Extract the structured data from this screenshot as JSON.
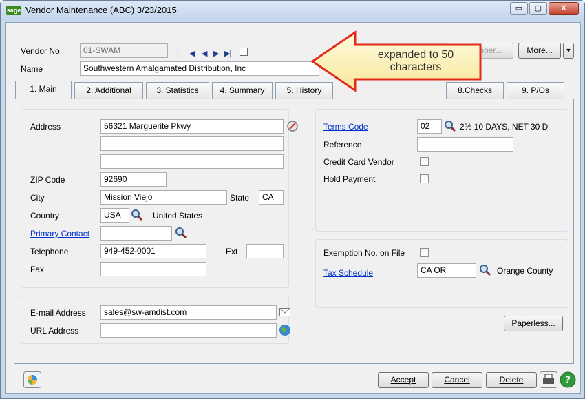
{
  "window": {
    "title": "Vendor Maintenance (ABC) 3/23/2015",
    "app_logo": "sage",
    "controls": {
      "minimize": "▭",
      "maximize": "▢",
      "close": "X"
    }
  },
  "header": {
    "vendor_no_label": "Vendor No.",
    "vendor_no_value": "01-SWAM",
    "name_label": "Name",
    "name_value": "Southwestern Amalgamated Distribution, Inc",
    "renumber_label": "Renumber...",
    "more_label": "More...",
    "callout": "expanded to 50 characters"
  },
  "tabs": [
    {
      "label": "1. Main"
    },
    {
      "label": "2. Additional"
    },
    {
      "label": "3. Statistics"
    },
    {
      "label": "4. Summary"
    },
    {
      "label": "5. History"
    },
    {
      "label": "8.Checks"
    },
    {
      "label": "9. P/Os"
    }
  ],
  "address": {
    "address_label": "Address",
    "line1": "56321 Marguerite Pkwy",
    "line2": "",
    "line3": "",
    "zip_label": "ZIP Code",
    "zip": "92690",
    "city_label": "City",
    "city": "Mission Viejo",
    "state_label": "State",
    "state": "CA",
    "country_label": "Country",
    "country_code": "USA",
    "country_name": "United States",
    "primary_contact_label": "Primary Contact",
    "primary_contact": "",
    "telephone_label": "Telephone",
    "telephone": "949-452-0001",
    "ext_label": "Ext",
    "ext": "",
    "fax_label": "Fax",
    "fax": ""
  },
  "web": {
    "email_label": "E-mail Address",
    "email": "sales@sw-amdist.com",
    "url_label": "URL Address",
    "url": ""
  },
  "terms": {
    "terms_code_label": "Terms Code",
    "terms_code": "02",
    "terms_desc": "2% 10 DAYS, NET 30 D",
    "reference_label": "Reference",
    "reference": "",
    "credit_card_label": "Credit Card Vendor",
    "hold_payment_label": "Hold Payment"
  },
  "tax": {
    "exemption_label": "Exemption No. on File",
    "tax_schedule_label": "Tax Schedule",
    "tax_schedule": "CA OR",
    "tax_schedule_desc": "Orange County"
  },
  "buttons": {
    "paperless": "Paperless...",
    "accept": "Accept",
    "cancel": "Cancel",
    "delete": "Delete"
  }
}
